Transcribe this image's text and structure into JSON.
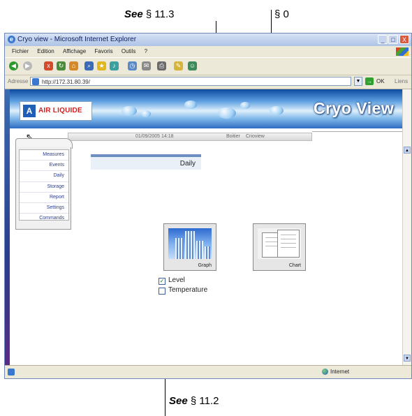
{
  "callouts": {
    "top_left": {
      "see": "See",
      "ref": "§ 11.3"
    },
    "top_right": {
      "ref": "§ 0"
    },
    "bottom": {
      "see": "See",
      "ref": "§ 11.2"
    }
  },
  "window": {
    "title": "Cryo view - Microsoft Internet Explorer",
    "controls": {
      "minimize": "_",
      "maximize": "□",
      "close": "X"
    }
  },
  "menu": [
    "Fichier",
    "Edition",
    "Affichage",
    "Favoris",
    "Outils",
    "?"
  ],
  "address": {
    "label": "Adresse",
    "url": "http://172.31.80.39/",
    "go_label": "OK",
    "links_label": "Liens"
  },
  "banner": {
    "logo_text": "AIR LIQUIDE",
    "logo_mark": "A",
    "brand": "Cryo View"
  },
  "infobar": {
    "datetime": "01/09/2005 14:18",
    "boitier": "Boitier",
    "cryoview": "Crioview"
  },
  "nav": {
    "items": [
      "Measures",
      "Events",
      "Daily",
      "Storage",
      "Report",
      "Settings",
      "Commands"
    ]
  },
  "page": {
    "title": "Daily"
  },
  "cards": {
    "graph": "Graph",
    "chart": "Chart"
  },
  "options": {
    "level": {
      "label": "Level",
      "checked": true
    },
    "temperature": {
      "label": "Temperature",
      "checked": false
    }
  },
  "statusbar": {
    "zone": "Internet"
  },
  "icons": [
    "ie-icon",
    "back-icon",
    "forward-icon",
    "stop-icon",
    "refresh-icon",
    "home-icon",
    "search-icon",
    "favorites-icon",
    "media-icon",
    "history-icon",
    "mail-icon",
    "print-icon",
    "edit-icon",
    "messenger-icon",
    "cursor-icon",
    "globe-icon"
  ]
}
